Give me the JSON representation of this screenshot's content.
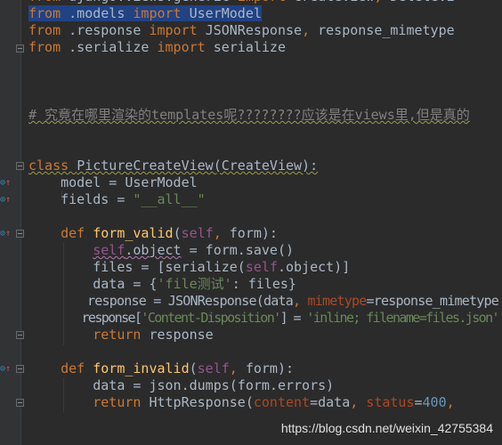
{
  "colors": {
    "background": "#2b2b2b",
    "gutter": "#313335",
    "keyword": "#cc7832",
    "string": "#6a8759",
    "self": "#94558d",
    "function": "#ffc66d",
    "named_param": "#aa4926",
    "number": "#6897bb",
    "comment": "#808080",
    "selection": "#214283"
  },
  "lines": [
    [
      [
        "from ",
        "kw"
      ],
      [
        "django.views.generic ",
        ""
      ],
      [
        "import ",
        "kw"
      ],
      [
        "CreateView",
        ""
      ],
      [
        ", ",
        "kw"
      ],
      [
        "DeleteVi",
        ""
      ]
    ],
    [
      [
        "from ",
        "kw sel"
      ],
      [
        ".models ",
        "sel"
      ],
      [
        "import ",
        "kw sel"
      ],
      [
        "UserModel",
        "sel"
      ]
    ],
    [
      [
        "from ",
        "kw"
      ],
      [
        ".response ",
        ""
      ],
      [
        "import ",
        "kw"
      ],
      [
        "JSONResponse",
        ""
      ],
      [
        ", ",
        "kw"
      ],
      [
        "response_mimetype",
        ""
      ]
    ],
    [
      [
        "from ",
        "kw"
      ],
      [
        ".serialize ",
        ""
      ],
      [
        "import ",
        "kw"
      ],
      [
        "serialize",
        ""
      ]
    ],
    [],
    [],
    [],
    [
      [
        "# 究竟在哪里渲染的templates呢????????应该是在views里,但是真的",
        "cm wavy"
      ]
    ],
    [],
    [],
    [
      [
        "class ",
        "kw wavy"
      ],
      [
        "PictureCreateView(CreateView):",
        "wavy"
      ]
    ],
    [
      [
        "    model = UserModel",
        ""
      ]
    ],
    [
      [
        "    fields = ",
        ""
      ],
      [
        "\"__all__\"",
        "str"
      ]
    ],
    [],
    [
      [
        "    ",
        ""
      ],
      [
        "def ",
        "kw"
      ],
      [
        "form_valid",
        "fn"
      ],
      [
        "(",
        ""
      ],
      [
        "self",
        "self"
      ],
      [
        ", ",
        "kw"
      ],
      [
        "form):",
        ""
      ]
    ],
    [
      [
        "        ",
        ""
      ],
      [
        "self",
        "self wavyp"
      ],
      [
        ".object",
        "wavyp"
      ],
      [
        " = form.save()",
        ""
      ]
    ],
    [
      [
        "        files = [serialize(",
        ""
      ],
      [
        "self",
        "self"
      ],
      [
        ".object)]",
        ""
      ]
    ],
    [
      [
        "        data = {",
        ""
      ],
      [
        "'file测试'",
        "str"
      ],
      [
        ": files}",
        ""
      ]
    ],
    [
      [
        "        response = JSONResponse(data",
        ""
      ],
      [
        ", ",
        "kw"
      ],
      [
        "mimetype",
        "param"
      ],
      [
        "=response_mimetype",
        ""
      ]
    ],
    [
      [
        "        response[",
        ""
      ],
      [
        "'Content-Disposition'",
        "str"
      ],
      [
        "] = ",
        ""
      ],
      [
        "'inline; filename=files.json'",
        "str"
      ]
    ],
    [
      [
        "        ",
        ""
      ],
      [
        "return ",
        "kw"
      ],
      [
        "response",
        ""
      ]
    ],
    [],
    [
      [
        "    ",
        ""
      ],
      [
        "def ",
        "kw"
      ],
      [
        "form_invalid",
        "fn"
      ],
      [
        "(",
        ""
      ],
      [
        "self",
        "self"
      ],
      [
        ", ",
        "kw"
      ],
      [
        "form):",
        ""
      ]
    ],
    [
      [
        "        data = json.dumps(form.errors)",
        ""
      ]
    ],
    [
      [
        "        ",
        ""
      ],
      [
        "return ",
        "kw"
      ],
      [
        "HttpResponse(",
        ""
      ],
      [
        "content",
        "param"
      ],
      [
        "=data",
        ""
      ],
      [
        ", ",
        "kw"
      ],
      [
        "status",
        "param"
      ],
      [
        "=",
        ""
      ],
      [
        "400",
        "num"
      ],
      [
        ", ",
        "kw"
      ]
    ]
  ],
  "watermark": "https://blog.csdn.net/weixin_42755384",
  "gutter_icons": [
    "override-marker",
    "override-marker",
    "override-marker",
    "override-marker"
  ]
}
